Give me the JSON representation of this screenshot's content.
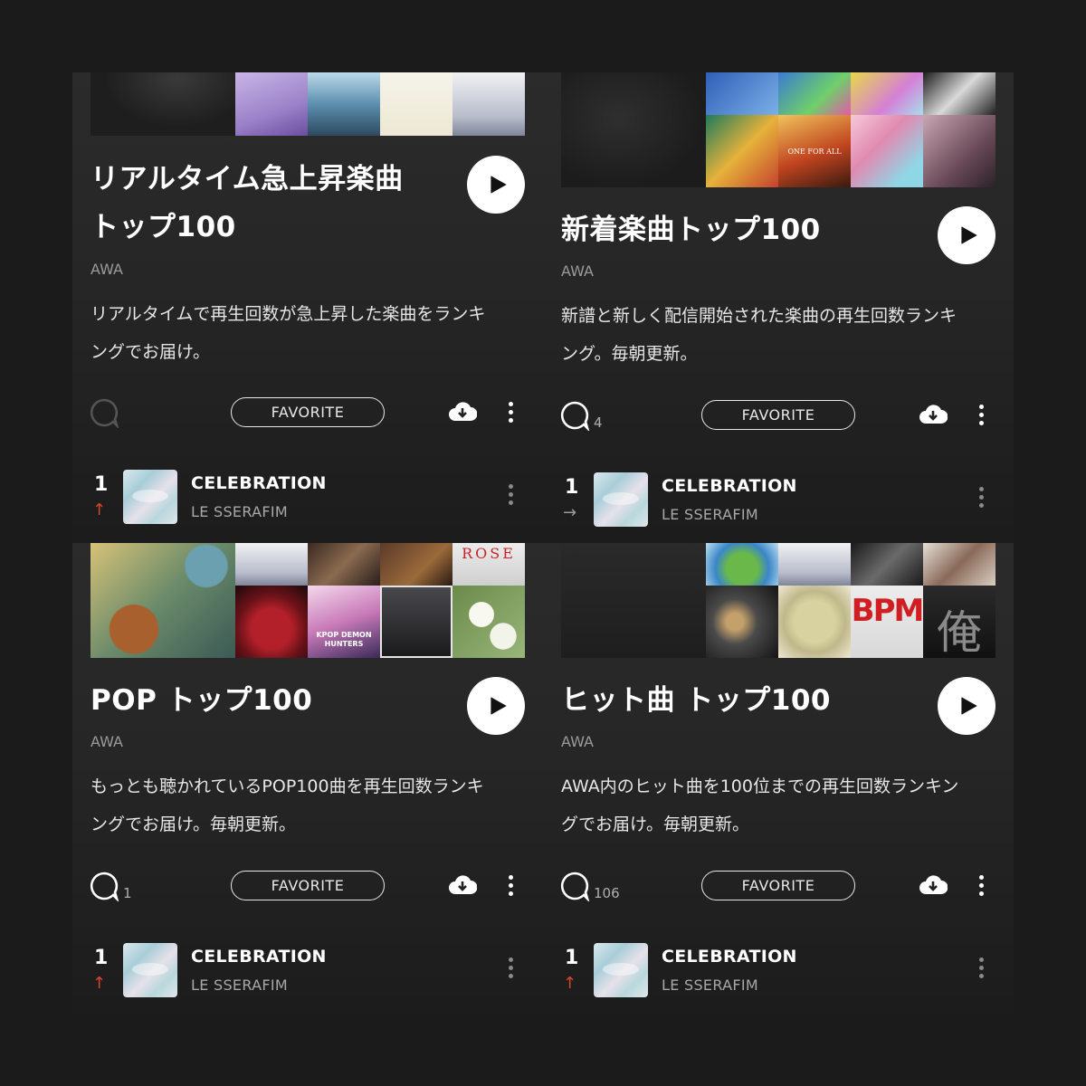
{
  "common": {
    "favorite_label": "FAVORITE"
  },
  "playlists": [
    {
      "title_line1": "リアルタイム急上昇楽曲",
      "title_line2": "トップ100",
      "owner": "AWA",
      "description_line1": "リアルタイムで再生回数が急上昇した楽曲をランキ",
      "description_line2": "ングでお届け。",
      "comment_count": "",
      "track": {
        "rank": "1",
        "trend": "↑",
        "trend_state": "up",
        "name": "CELEBRATION",
        "artist": "LE SSERAFIM"
      }
    },
    {
      "title_line1": "新着楽曲トップ100",
      "owner": "AWA",
      "description_line1": "新譜と新しく配信開始された楽曲の再生回数ランキ",
      "description_line2": "ング。毎朝更新。",
      "comment_count": "4",
      "track": {
        "rank": "1",
        "trend": "→",
        "trend_state": "same",
        "name": "CELEBRATION",
        "artist": "LE SSERAFIM"
      }
    },
    {
      "title_line1": "POP トップ100",
      "owner": "AWA",
      "description_line1": "もっとも聴かれているPOP100曲を再生回数ランキ",
      "description_line2": "ングでお届け。毎朝更新。",
      "comment_count": "1",
      "track": {
        "rank": "1",
        "trend": "↑",
        "trend_state": "up",
        "name": "CELEBRATION",
        "artist": "LE SSERAFIM"
      }
    },
    {
      "title_line1": "ヒット曲 トップ100",
      "owner": "AWA",
      "description_line1": "AWA内のヒット曲を100位までの再生回数ランキン",
      "description_line2": "グでお届け。毎朝更新。",
      "comment_count": "106",
      "track": {
        "rank": "1",
        "trend": "↑",
        "trend_state": "up",
        "name": "CELEBRATION",
        "artist": "LE SSERAFIM"
      }
    }
  ],
  "artwork_text": {
    "rose_cover": "ROSE",
    "kpop_cover": "KPOP DEMON HUNTERS",
    "one_for_all_cover": "ONE FOR ALL",
    "bpm_cover": "BPM",
    "kanji_cover": "俺"
  },
  "colors": {
    "background": "#1b1b1b",
    "panel": "#2b2b2b",
    "trend_up": "#d9452b",
    "text_secondary": "#9a9a9a"
  }
}
